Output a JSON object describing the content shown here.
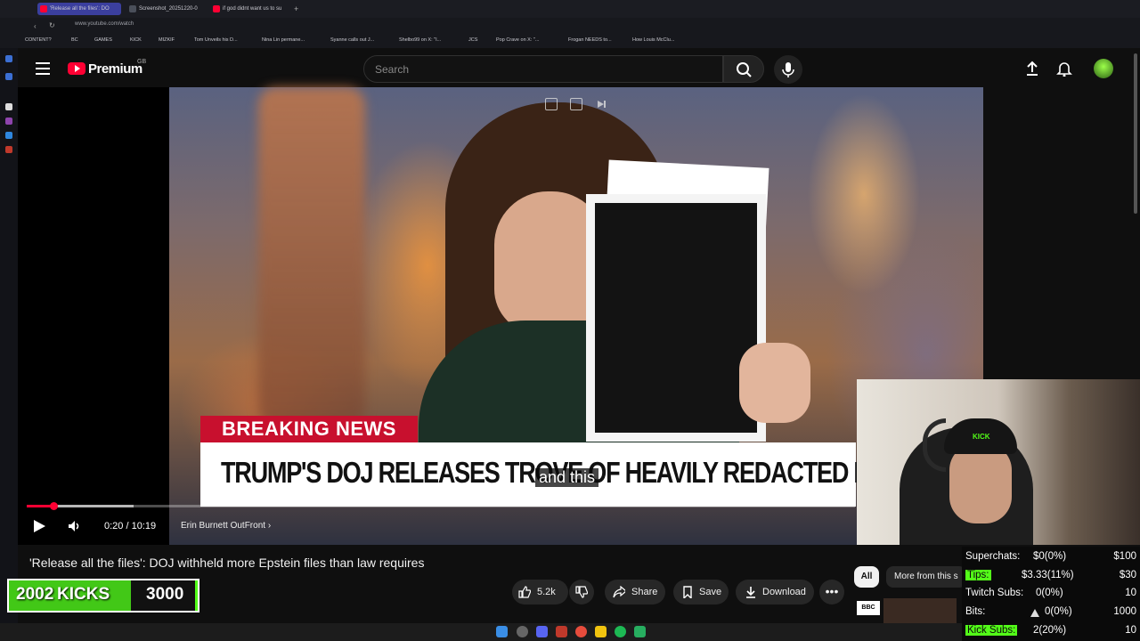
{
  "browser": {
    "tabs": [
      {
        "label": "'Release all the files': DO",
        "color": "#ff0033",
        "active": true
      },
      {
        "label": "Screenshot_20251220-0",
        "color": "#4a4f5a",
        "active": false
      },
      {
        "label": "if god didnt want us to su",
        "color": "#ff0033",
        "active": false
      }
    ],
    "url": "www.youtube.com/watch",
    "bookmarks": [
      "CONTENT?",
      "BC",
      "GAMES",
      "KICK",
      "MIZKIF",
      "Tom Unveils his D...",
      "Nina Lin permane...",
      "Syanne calls out J...",
      "Shelbo99 on X: \"I...",
      "JCS",
      "Pop Crave on X: \"...",
      "Frogan NEEDS to...",
      "How Louis McClu..."
    ]
  },
  "youtube": {
    "logo_text": "Premium",
    "region": "GB",
    "search_placeholder": "Search"
  },
  "video": {
    "breaking_label": "BREAKING NEWS",
    "headline": "TRUMP'S DOJ RELEASES TROVE OF HEAVILY REDACTED EPSTEIN DOCS",
    "caption": "and this",
    "time": "0:20 / 10:19",
    "progress_fraction": 0.032,
    "channel_chapter": "Erin Burnett OutFront",
    "title": "'Release all the files': DOJ withheld more Epstein files than law requires"
  },
  "actions": {
    "likes": "5.2k",
    "share": "Share",
    "save": "Save",
    "download": "Download"
  },
  "chips": {
    "all": "All",
    "more": "More from this s"
  },
  "kicks_goal": {
    "count": "2002",
    "label": "KICKS",
    "goal": "3000",
    "progress_fraction": 0.667
  },
  "webcam": {
    "hat_text": "KICK"
  },
  "stats": [
    {
      "label": "Superchats:",
      "value": "$0(0%)",
      "goal": "$100",
      "highlight": false
    },
    {
      "label": "Tips:",
      "value": "$3.33(11%)",
      "goal": "$30",
      "highlight": true
    },
    {
      "label": "Twitch Subs:",
      "value": "0(0%)",
      "goal": "10",
      "highlight": false
    },
    {
      "label": "Bits:",
      "value": "0(0%)",
      "goal": "1000",
      "highlight": false
    },
    {
      "label": "Kick Subs:",
      "value": "2(20%)",
      "goal": "10",
      "highlight": true
    }
  ],
  "colors": {
    "yt_red": "#ff0033",
    "kick_green": "#53fc18",
    "breaking_red": "#c8102e"
  }
}
